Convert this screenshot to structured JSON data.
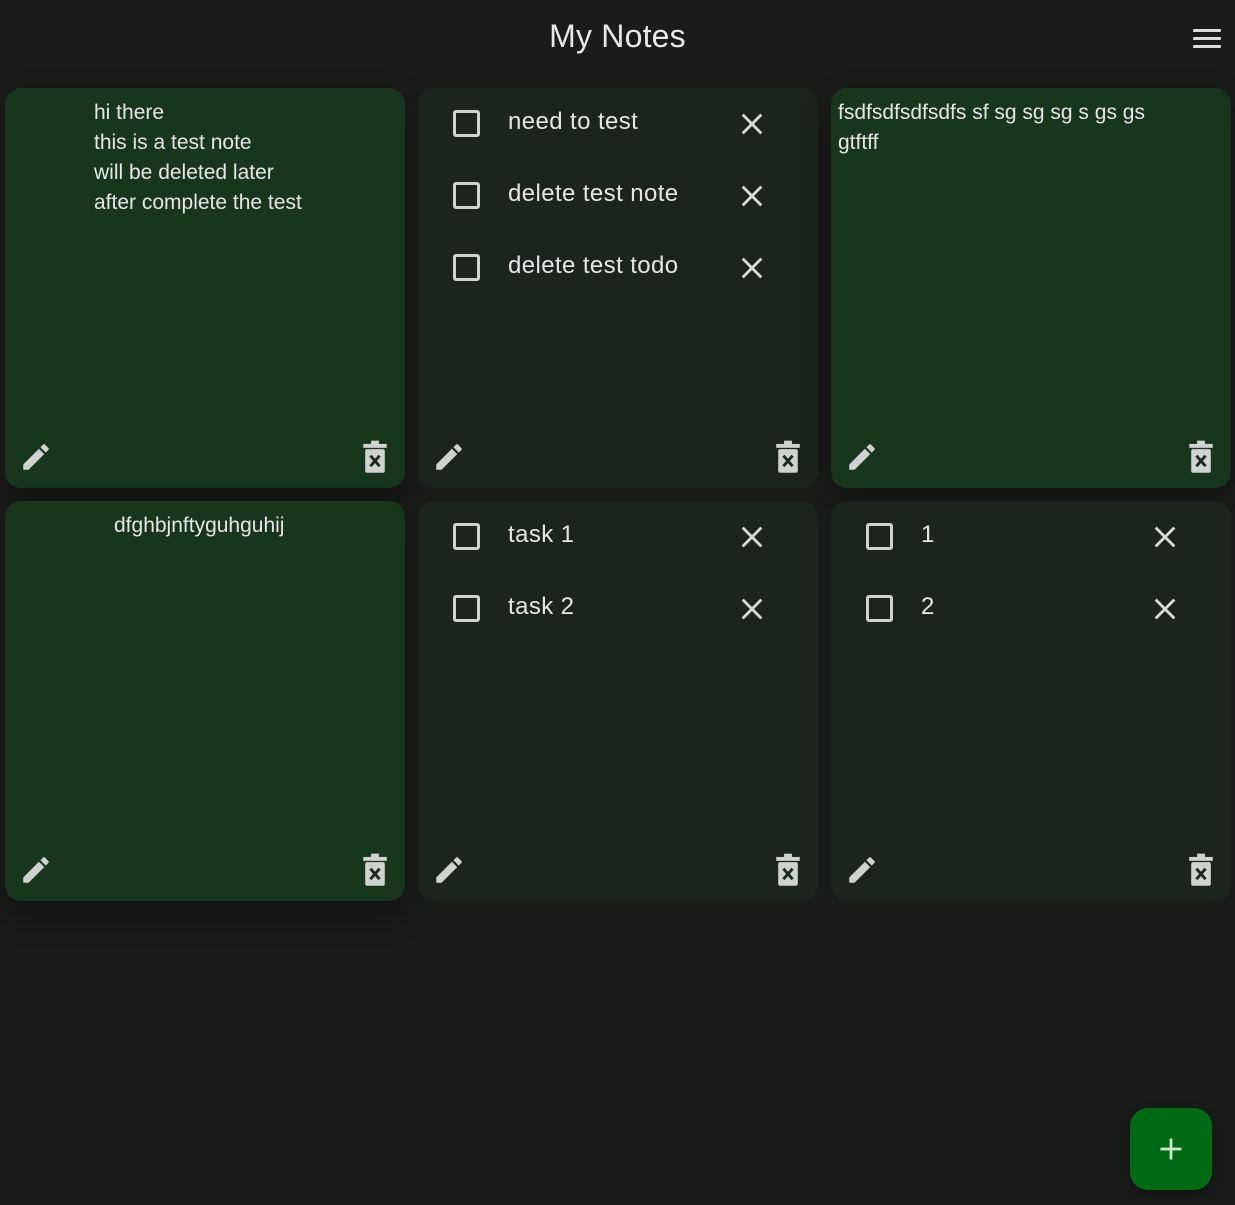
{
  "app": {
    "title": "My Notes"
  },
  "icons": {
    "menu": "menu-icon",
    "edit": "pencil-icon",
    "delete": "trash-x-icon",
    "remove_item": "close-icon",
    "checkbox": "checkbox-empty",
    "add": "plus-icon"
  },
  "colors": {
    "background": "#1a1c1a",
    "note_card": "#17361c",
    "todo_card": "#1b241d",
    "fab": "#006a15",
    "text": "#e6e6e6"
  },
  "cards": [
    {
      "type": "note",
      "text": "hi there\nthis is a test note\nwill be deleted later\nafter complete the test"
    },
    {
      "type": "todo",
      "items": [
        {
          "label": "need to test",
          "checked": false
        },
        {
          "label": "delete test note",
          "checked": false
        },
        {
          "label": "delete test todo",
          "checked": false
        }
      ]
    },
    {
      "type": "note",
      "text": "fsdfsdfsdfsdfs sf  sg sg sg s gs gs\ngtftff"
    },
    {
      "type": "note",
      "text": "dfghbjnftyguhguhij"
    },
    {
      "type": "todo",
      "items": [
        {
          "label": "task 1",
          "checked": false
        },
        {
          "label": "task 2",
          "checked": false
        }
      ]
    },
    {
      "type": "todo",
      "items": [
        {
          "label": "1",
          "checked": false
        },
        {
          "label": "2",
          "checked": false
        }
      ]
    }
  ]
}
